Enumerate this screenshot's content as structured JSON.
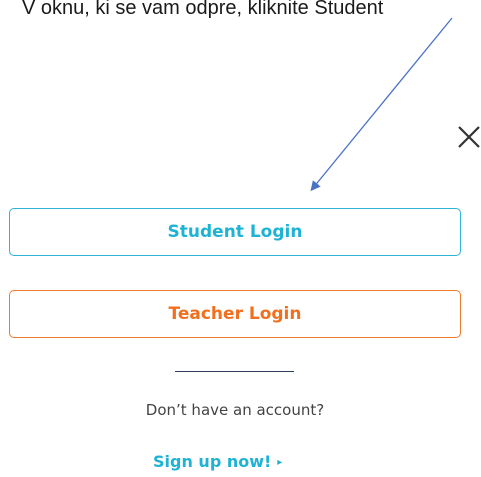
{
  "instruction": {
    "text": "V oknu, ki se vam odpre, kliknite Student"
  },
  "close": {
    "icon": "close-icon",
    "glyph": "✕"
  },
  "login": {
    "student_label": "Student Login",
    "teacher_label": "Teacher Login"
  },
  "signup": {
    "prompt": "Don’t have an account?",
    "link_label": "Sign up now!",
    "chevron_icon": "chevron-right-icon",
    "chevron_glyph": "▸"
  },
  "colors": {
    "student_accent": "#1eb3d4",
    "teacher_accent": "#f26f1e",
    "arrow": "#4a72c4",
    "divider": "#2c3e5c"
  }
}
